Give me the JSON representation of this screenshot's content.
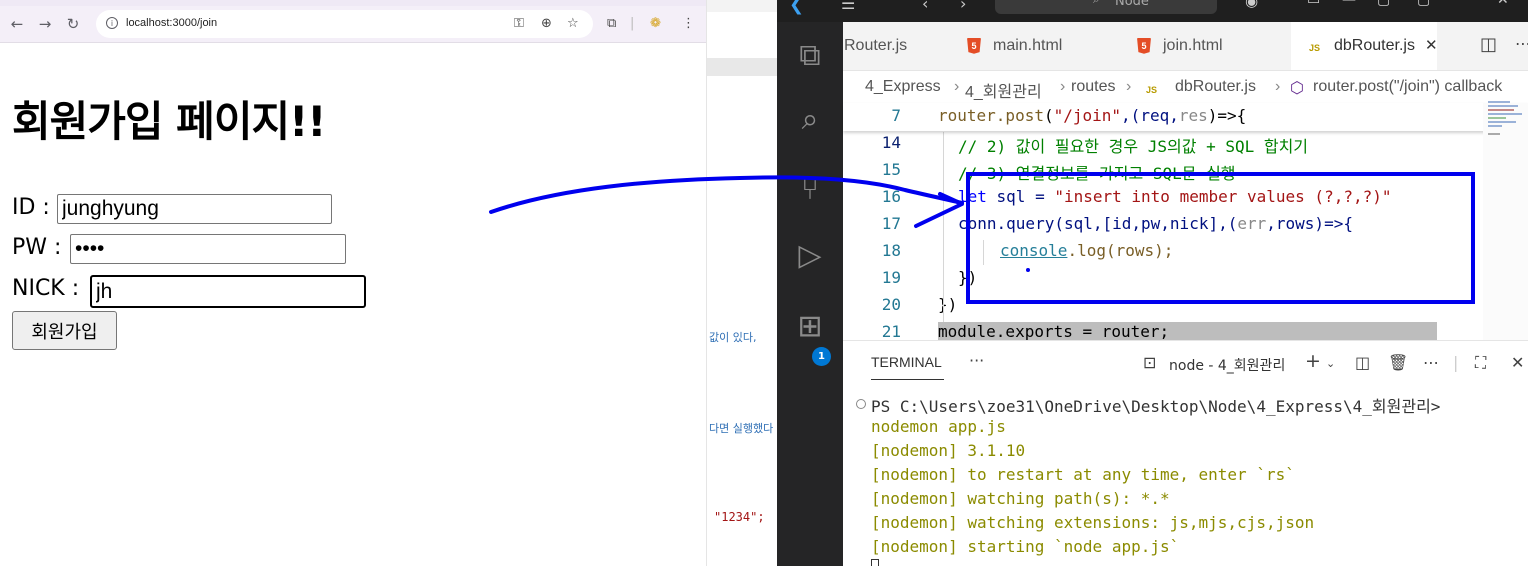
{
  "browser": {
    "url": "localhost:3000/join",
    "page_title": "회원가입 페이지!!",
    "form": {
      "id_label": "ID :",
      "id_value": "junghyung",
      "pw_label": "PW :",
      "pw_value": "••••",
      "nick_label": "NICK :",
      "nick_value": "jh",
      "submit_label": "회원가입"
    }
  },
  "midstrip": {
    "text1": "값이 있다,",
    "text2": "다면 실행했다",
    "string": "\"1234\";"
  },
  "vscode": {
    "search_text": "Node",
    "tabs": [
      {
        "label": "Router.js"
      },
      {
        "label": "main.html"
      },
      {
        "label": "join.html"
      },
      {
        "label": "dbRouter.js",
        "active": true
      }
    ],
    "breadcrumb": [
      "4_Express",
      "4_회원관리",
      "routes",
      "dbRouter.js",
      "router.post(\"/join\") callback"
    ],
    "extension_badge": "1",
    "code": {
      "sticky_line_no": "7",
      "line_numbers": [
        "14",
        "15",
        "16",
        "17",
        "18",
        "19",
        "20",
        "21"
      ],
      "sticky": {
        "fn": "router.post",
        "p1": "(",
        "str": "\"/join\"",
        "p2": ",(req,",
        "dimarg": "res",
        "p3": ")=>{"
      },
      "l14": "// 2) 값이 필요한 경우 JS의값 + SQL 합치기",
      "l15": "// 3) 연결정보를 가지고 SQL문 실행",
      "l16": {
        "kw": "let",
        "var": " sql = ",
        "str": "\"insert into member values (?,?,?)\""
      },
      "l17": {
        "a": "conn.query(sql,[id,pw,nick],(",
        "dim": "err",
        "b": ",rows)=>{"
      },
      "l18": {
        "obj": "console",
        "rest": ".log(rows);"
      },
      "l19": "})",
      "l20": "})",
      "l21": "module.exports = router;"
    },
    "terminal": {
      "tab": "TERMINAL",
      "more": "···",
      "name": "node - 4_회원관리",
      "lines": [
        "PS C:\\Users\\zoe31\\OneDrive\\Desktop\\Node\\4_Express\\4_회원관리>",
        "nodemon app.js",
        "[nodemon] 3.1.10",
        "[nodemon] to restart at any time, enter `rs`",
        "[nodemon] watching path(s): *.*",
        "[nodemon] watching extensions: js,mjs,cjs,json",
        "[nodemon] starting `node app.js`"
      ]
    }
  },
  "colors": {
    "annotation": "#0000ee",
    "nodemon_text": "#8b8b00",
    "keyword": "#0000ff",
    "string": "#a31515",
    "comment": "#008000"
  }
}
